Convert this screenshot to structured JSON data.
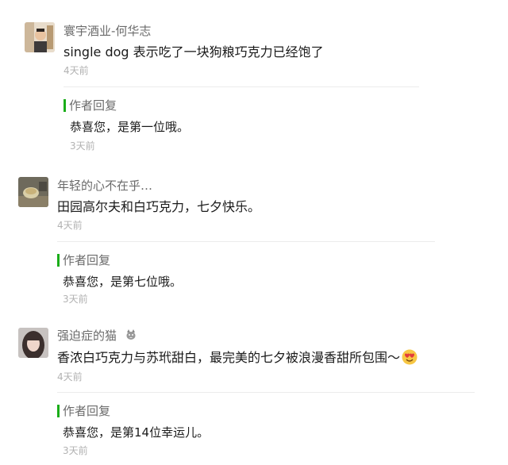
{
  "comments": [
    {
      "nickname": "寰宇酒业-何华志",
      "text": "single dog 表示吃了一块狗粮巧克力已经饱了",
      "time": "4天前",
      "reply": {
        "label": "作者回复",
        "text": "恭喜您，是第一位哦。",
        "time": "3天前"
      }
    },
    {
      "nickname": "年轻的心不在乎…",
      "text": "田园高尔夫和白巧克力，七夕快乐。",
      "time": "4天前",
      "reply": {
        "label": "作者回复",
        "text": "恭喜您，是第七位哦。",
        "time": "3天前"
      }
    },
    {
      "nickname": "强迫症的猫",
      "nickname_icon": "cat-icon",
      "text": "香浓白巧克力与苏玳甜白，最完美的七夕被浪漫香甜所包围～",
      "text_emoji": "heart-eyes-emoji",
      "time": "4天前",
      "reply": {
        "label": "作者回复",
        "text": "恭喜您，是第14位幸运儿。",
        "time": "3天前"
      }
    }
  ],
  "colors": {
    "reply_bar": "#1aad19",
    "nickname": "#6b6b6b",
    "time": "#b2b2b2",
    "content": "#1a1a1a"
  }
}
